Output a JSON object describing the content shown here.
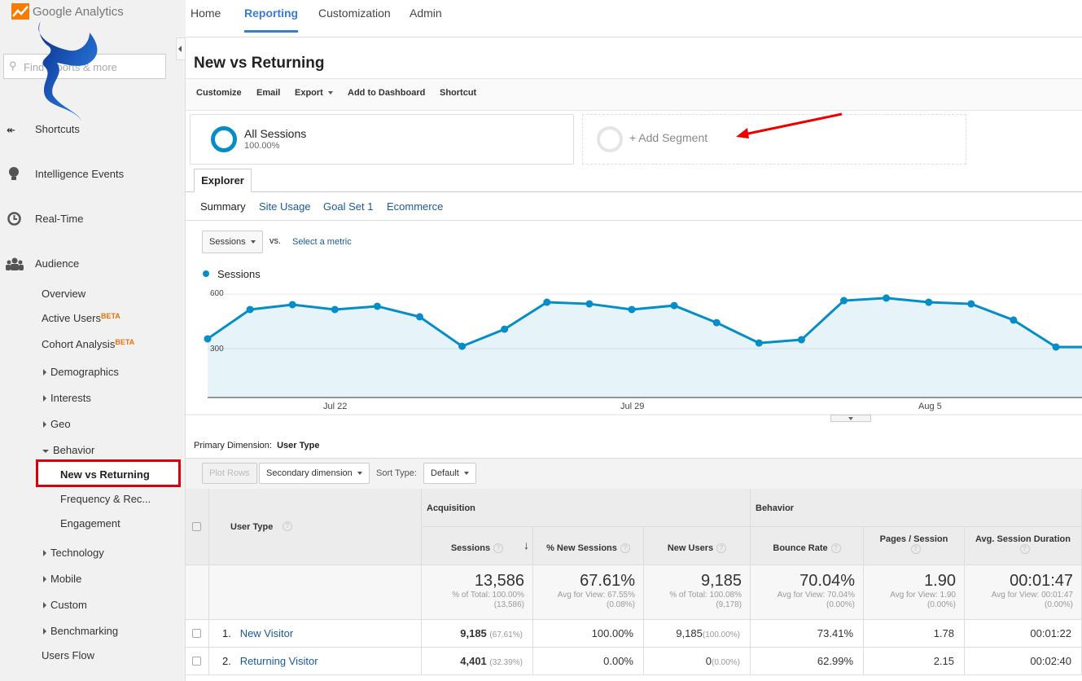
{
  "app": {
    "brand": "Google Analytics",
    "nav": [
      "Home",
      "Reporting",
      "Customization",
      "Admin"
    ],
    "active_nav": "Reporting"
  },
  "sidebar": {
    "search_placeholder": "Find reports & more",
    "sections": [
      {
        "label": "Shortcuts",
        "icon": "shortcut-icon"
      },
      {
        "label": "Intelligence Events",
        "icon": "lightbulb-icon"
      },
      {
        "label": "Real-Time",
        "icon": "clock-icon"
      },
      {
        "label": "Audience",
        "icon": "people-icon"
      }
    ],
    "audience_items": [
      {
        "label": "Overview"
      },
      {
        "label": "Active Users",
        "badge": "BETA"
      },
      {
        "label": "Cohort Analysis",
        "badge": "BETA"
      },
      {
        "label": "Demographics"
      },
      {
        "label": "Interests"
      },
      {
        "label": "Geo"
      },
      {
        "label": "Behavior"
      },
      {
        "label": "New vs Returning"
      },
      {
        "label": "Frequency & Rec..."
      },
      {
        "label": "Engagement"
      },
      {
        "label": "Technology"
      },
      {
        "label": "Mobile"
      },
      {
        "label": "Custom"
      },
      {
        "label": "Benchmarking"
      },
      {
        "label": "Users Flow"
      }
    ],
    "highlight_color": "#d9000d"
  },
  "page": {
    "title": "New vs Returning",
    "toolbar": [
      "Customize",
      "Email",
      "Export",
      "Add to Dashboard",
      "Shortcut"
    ]
  },
  "segments": {
    "all": {
      "name": "All Sessions",
      "pct": "100.00%"
    },
    "add": "+ Add Segment"
  },
  "explorer": {
    "tab": "Explorer",
    "subtabs": [
      "Summary",
      "Site Usage",
      "Goal Set 1",
      "Ecommerce"
    ],
    "metric": "Sessions",
    "vs": "vs.",
    "select_metric": "Select a metric"
  },
  "chart_data": {
    "type": "area",
    "legend": "Sessions",
    "color": "#058dc7",
    "ylim": [
      0,
      600
    ],
    "yticks": [
      "600",
      "300"
    ],
    "xtick_labels": [
      "Jul 22",
      "Jul 29",
      "Aug 5"
    ],
    "x": [
      "Jul 19",
      "Jul 20",
      "Jul 21",
      "Jul 22",
      "Jul 23",
      "Jul 24",
      "Jul 25",
      "Jul 26",
      "Jul 27",
      "Jul 28",
      "Jul 29",
      "Jul 30",
      "Jul 31",
      "Aug 1",
      "Aug 2",
      "Aug 3",
      "Aug 4",
      "Aug 5",
      "Aug 6",
      "Aug 7",
      "Aug 8",
      "Aug 9"
    ],
    "values": [
      354,
      515,
      542,
      515,
      533,
      475,
      313,
      407,
      555,
      546,
      515,
      537,
      443,
      331,
      349,
      564,
      578,
      555,
      546,
      457,
      309,
      309
    ]
  },
  "table": {
    "primary_dimension_label": "Primary Dimension:",
    "primary_dimension": "User Type",
    "plot_rows": "Plot Rows",
    "secondary": "Secondary dimension",
    "sort_label": "Sort Type:",
    "sort": "Default",
    "groups": [
      "Acquisition",
      "Behavior"
    ],
    "dim_header": "User Type",
    "columns": [
      "Sessions",
      "% New Sessions",
      "New Users",
      "Bounce Rate",
      "Pages / Session",
      "Avg. Session Duration"
    ],
    "totals": [
      {
        "v": "13,586",
        "a": "% of Total: 100.00%",
        "b": "(13,586)"
      },
      {
        "v": "67.61%",
        "a": "Avg for View: 67.55%",
        "b": "(0.08%)"
      },
      {
        "v": "9,185",
        "a": "% of Total: 100.08%",
        "b": "(9,178)"
      },
      {
        "v": "70.04%",
        "a": "Avg for View: 70.04%",
        "b": "(0.00%)"
      },
      {
        "v": "1.90",
        "a": "Avg for View: 1.90",
        "b": "(0.00%)"
      },
      {
        "v": "00:01:47",
        "a": "Avg for View: 00:01:47",
        "b": "(0.00%)"
      }
    ],
    "rows": [
      {
        "n": "1.",
        "name": "New Visitor",
        "sessions": "9,185",
        "sessions_pct": "(67.61%)",
        "new_sessions": "100.00%",
        "new_users": "9,185",
        "new_users_pct": "(100.00%)",
        "bounce": "73.41%",
        "pages": "1.78",
        "duration": "00:01:22"
      },
      {
        "n": "2.",
        "name": "Returning Visitor",
        "sessions": "4,401",
        "sessions_pct": "(32.39%)",
        "new_sessions": "0.00%",
        "new_users": "0",
        "new_users_pct": "(0.00%)",
        "bounce": "62.99%",
        "pages": "2.15",
        "duration": "00:02:40"
      }
    ]
  }
}
